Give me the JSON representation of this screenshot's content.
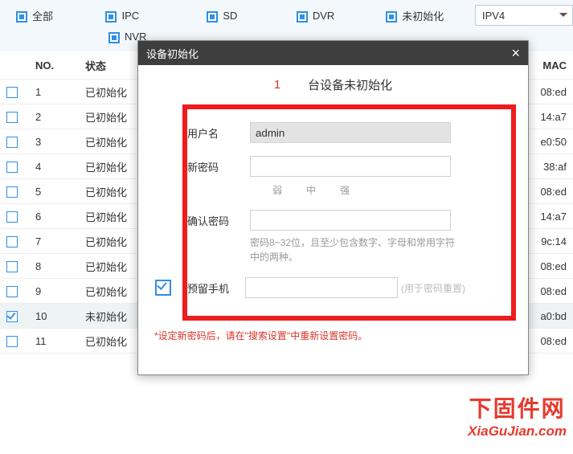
{
  "filters": {
    "all": "全部",
    "ipc": "IPC",
    "sd": "SD",
    "dvr": "DVR",
    "uninit": "未初始化",
    "nvr": "NVR",
    "ipversion": "IPV4"
  },
  "table": {
    "headers": {
      "no": "NO.",
      "status": "状态",
      "mac": "MAC"
    },
    "rows": [
      {
        "no": "1",
        "status": "已初始化",
        "mac": "08:ed"
      },
      {
        "no": "2",
        "status": "已初始化",
        "mac": "14:a7"
      },
      {
        "no": "3",
        "status": "已初始化",
        "mac": "e0:50"
      },
      {
        "no": "4",
        "status": "已初始化",
        "mac": "38:af"
      },
      {
        "no": "5",
        "status": "已初始化",
        "mac": "08:ed"
      },
      {
        "no": "6",
        "status": "已初始化",
        "mac": "14:a7"
      },
      {
        "no": "7",
        "status": "已初始化",
        "mac": "9c:14"
      },
      {
        "no": "8",
        "status": "已初始化",
        "mac": "08:ed"
      },
      {
        "no": "9",
        "status": "已初始化",
        "mac": "08:ed"
      },
      {
        "no": "10",
        "status": "未初始化",
        "mac": "a0:bd",
        "selected": true
      },
      {
        "no": "11",
        "status": "已初始化",
        "mac": "08:ed"
      }
    ]
  },
  "dialog": {
    "title": "设备初始化",
    "count": "1",
    "count_suffix": "台设备未初始化",
    "user_label": "用户名",
    "user_value": "admin",
    "newpwd_label": "新密码",
    "strength": {
      "weak": "弱",
      "mid": "中",
      "strong": "强"
    },
    "confirm_label": "确认密码",
    "pwd_hint": "密码8~32位，且至少包含数字、字母和常用字符中的两种。",
    "phone_label": "预留手机",
    "phone_side": "(用于密码重置)",
    "footnote": "*设定新密码后，请在\"搜索设置\"中重新设置密码。"
  },
  "watermark": {
    "cn": "下固件网",
    "en": "XiaGuJian.com"
  }
}
